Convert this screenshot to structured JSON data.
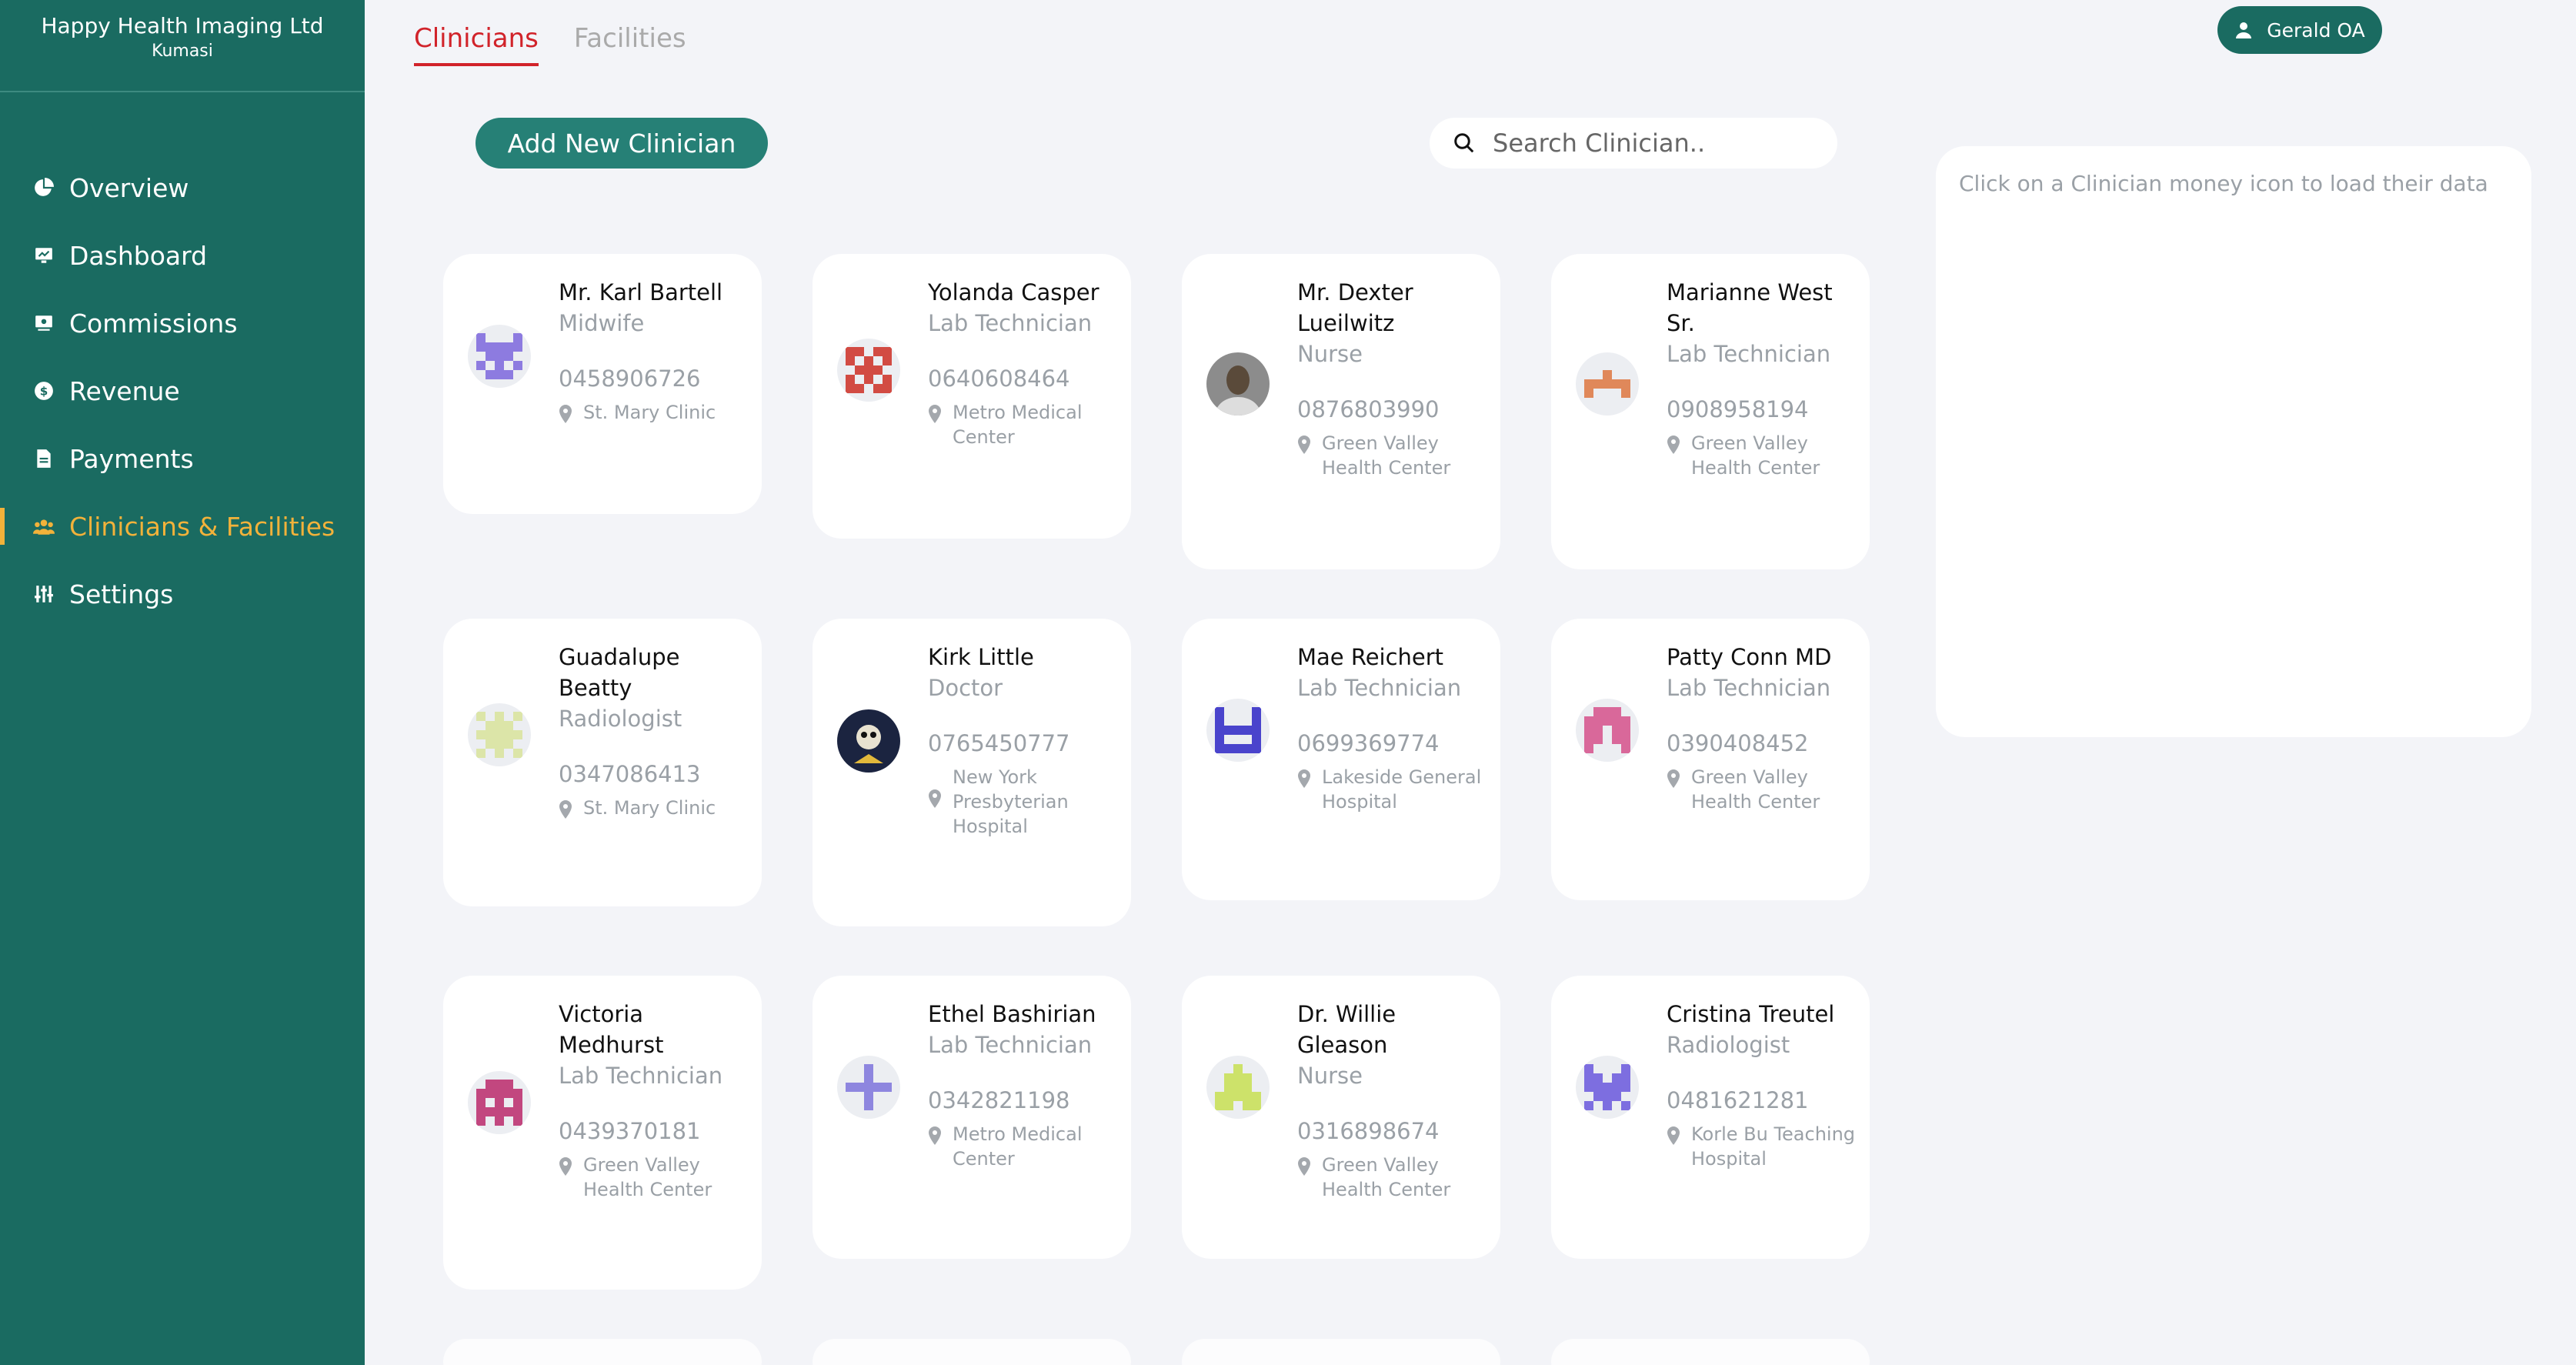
{
  "sidebar": {
    "company": "Happy Health Imaging Ltd",
    "city": "Kumasi",
    "nav": [
      {
        "label": "Overview",
        "icon": "pie-chart-icon"
      },
      {
        "label": "Dashboard",
        "icon": "dashboard-icon"
      },
      {
        "label": "Commissions",
        "icon": "commissions-icon"
      },
      {
        "label": "Revenue",
        "icon": "dollar-icon"
      },
      {
        "label": "Payments",
        "icon": "document-icon"
      },
      {
        "label": "Clinicians & Facilities",
        "icon": "people-icon",
        "active": true
      },
      {
        "label": "Settings",
        "icon": "sliders-icon"
      }
    ]
  },
  "tabs": [
    {
      "label": "Clinicians",
      "active": true
    },
    {
      "label": "Facilities",
      "active": false
    }
  ],
  "user": {
    "name": "Gerald OA"
  },
  "actions": {
    "add_label": "Add New Clinician"
  },
  "search": {
    "placeholder": "Search Clinician.."
  },
  "panel": {
    "message": "Click on a Clinician money icon to load their data"
  },
  "colors": {
    "sidebar": "#1a6b61",
    "accent": "#f2b23a",
    "tab_active": "#d1232a",
    "button": "#268076"
  },
  "clinicians": [
    {
      "name": "Mr. Karl Bartell",
      "role": "Midwife",
      "phone": "0458906726",
      "facility": "St. Mary Clinic",
      "avatar_color": "#8d7be0"
    },
    {
      "name": "Yolanda Casper",
      "role": "Lab Technician",
      "phone": "0640608464",
      "facility": "Metro Medical Center",
      "avatar_color": "#d24b43"
    },
    {
      "name": "Mr. Dexter Lueilwitz",
      "role": "Nurse",
      "phone": "0876803990",
      "facility": "Green Valley Health Center",
      "avatar_color": "#5a4a3a"
    },
    {
      "name": "Marianne West Sr.",
      "role": "Lab Technician",
      "phone": "0908958194",
      "facility": "Green Valley Health Center",
      "avatar_color": "#e0885a"
    },
    {
      "name": "Guadalupe Beatty",
      "role": "Radiologist",
      "phone": "0347086413",
      "facility": "St. Mary Clinic",
      "avatar_color": "#dce5a8"
    },
    {
      "name": "Kirk Little",
      "role": "Doctor",
      "phone": "0765450777",
      "facility": "New York Presbyterian Hospital",
      "avatar_color": "#1b2440"
    },
    {
      "name": "Mae Reichert",
      "role": "Lab Technician",
      "phone": "0699369774",
      "facility": "Lakeside General Hospital",
      "avatar_color": "#4a44cc"
    },
    {
      "name": "Patty Conn MD",
      "role": "Lab Technician",
      "phone": "0390408452",
      "facility": "Green Valley Health Center",
      "avatar_color": "#d9689a"
    },
    {
      "name": "Victoria Medhurst",
      "role": "Lab Technician",
      "phone": "0439370181",
      "facility": "Green Valley Health Center",
      "avatar_color": "#c2477f"
    },
    {
      "name": "Ethel Bashirian",
      "role": "Lab Technician",
      "phone": "0342821198",
      "facility": "Metro Medical Center",
      "avatar_color": "#8e86df"
    },
    {
      "name": "Dr. Willie Gleason",
      "role": "Nurse",
      "phone": "0316898674",
      "facility": "Green Valley Health Center",
      "avatar_color": "#cde26a"
    },
    {
      "name": "Cristina Treutel",
      "role": "Radiologist",
      "phone": "0481621281",
      "facility": "Korle Bu Teaching Hospital",
      "avatar_color": "#7d6ee0"
    }
  ]
}
